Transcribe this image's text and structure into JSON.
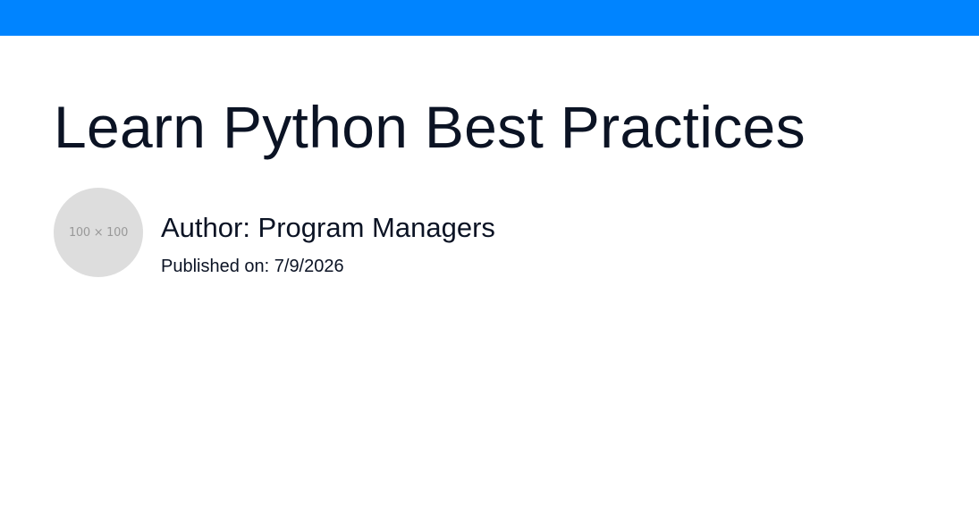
{
  "header": {
    "bar_color": "#0084ff"
  },
  "article": {
    "title": "Learn Python Best Practices",
    "author_line": "Author: Program Managers",
    "published_line": "Published on: 7/9/2026",
    "avatar": {
      "placeholder_text": "100 × 100",
      "background": "#dddddd"
    }
  }
}
